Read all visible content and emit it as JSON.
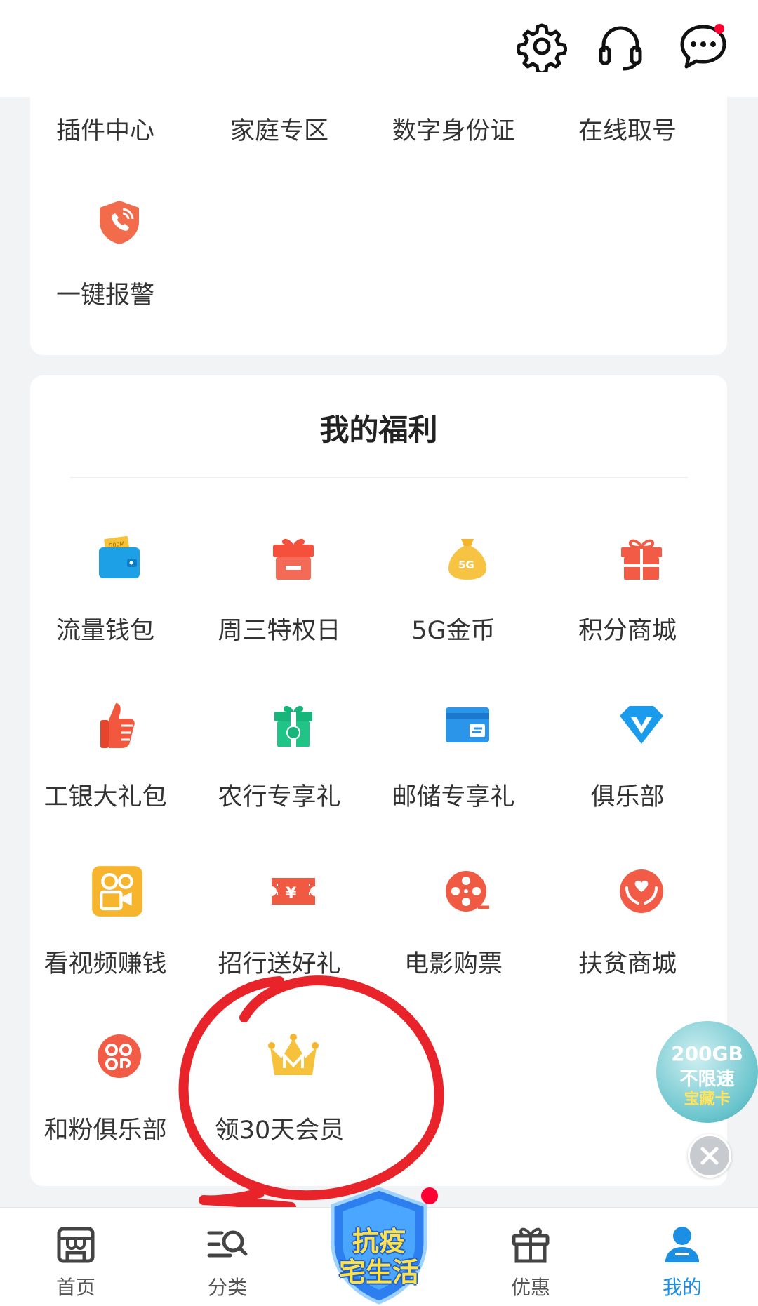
{
  "header": {
    "icons": [
      "gear-icon",
      "headset-icon",
      "message-icon"
    ]
  },
  "services": {
    "row1": [
      "插件中心",
      "家庭专区",
      "数字身份证",
      "在线取号"
    ],
    "row2": [
      "一键报警"
    ]
  },
  "welfare": {
    "title": "我的福利",
    "items": [
      {
        "label": "流量钱包",
        "icon": "wallet-icon",
        "badge": "500M"
      },
      {
        "label": "周三特权日",
        "icon": "gift-box-icon"
      },
      {
        "label": "5G金币",
        "icon": "money-bag-icon",
        "badge": "5G"
      },
      {
        "label": "积分商城",
        "icon": "present-icon"
      },
      {
        "label": "工银大礼包",
        "icon": "thumbs-up-icon"
      },
      {
        "label": "农行专享礼",
        "icon": "gift-green-icon"
      },
      {
        "label": "邮储专享礼",
        "icon": "bank-card-icon"
      },
      {
        "label": "俱乐部",
        "icon": "diamond-icon"
      },
      {
        "label": "看视频赚钱",
        "icon": "video-camera-icon"
      },
      {
        "label": "招行送好礼",
        "icon": "ticket-icon",
        "badge": "¥"
      },
      {
        "label": "电影购票",
        "icon": "film-reel-icon"
      },
      {
        "label": "扶贫商城",
        "icon": "heart-hands-icon"
      },
      {
        "label": "和粉俱乐部",
        "icon": "hefen-logo-icon"
      },
      {
        "label": "领30天会员",
        "icon": "crown-icon"
      }
    ]
  },
  "float_ad": {
    "line1": "200GB",
    "line2": "不限速",
    "line3": "宝藏卡"
  },
  "tabbar": {
    "tabs": [
      {
        "label": "首页",
        "icon": "store-icon"
      },
      {
        "label": "分类",
        "icon": "category-search-icon"
      },
      {
        "label": "优惠",
        "icon": "gift-icon"
      },
      {
        "label": "我的",
        "icon": "user-icon"
      }
    ],
    "center": {
      "line1": "抗疫",
      "line2": "宅生活"
    },
    "active": "我的"
  },
  "colors": {
    "accent": "#1a8fe3",
    "annotation": "#e8232a",
    "badge": "#ff0033"
  }
}
